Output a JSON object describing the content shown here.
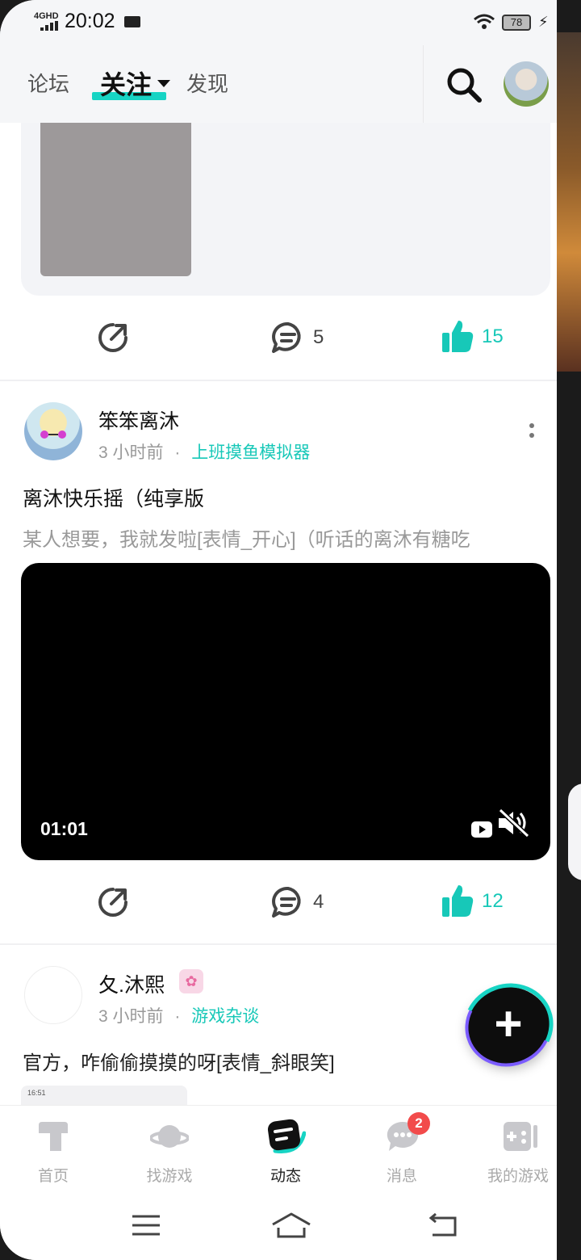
{
  "status_bar": {
    "network": "4GHD",
    "time": "20:02",
    "battery": "78"
  },
  "top_nav": {
    "tabs": [
      "论坛",
      "关注",
      "发现"
    ],
    "active_tab": "关注"
  },
  "posts": [
    {
      "comments": "5",
      "likes": "15"
    },
    {
      "author": "笨笨离沐",
      "time": "3 小时前",
      "topic": "上班摸鱼模拟器",
      "title": "离沐快乐摇（纯享版",
      "text": "某人想要，我就发啦[表情_开心]（听话的离沐有糖吃",
      "video_duration": "01:01",
      "comments": "4",
      "likes": "12"
    },
    {
      "author": "夂.沐熙",
      "time": "3 小时前",
      "topic": "游戏杂谈",
      "text": "官方，咋偷偷摸摸的呀[表情_斜眼笑]",
      "preview_time": "16:51"
    }
  ],
  "meta_separator": "·",
  "bottom_tabs": [
    {
      "label": "首页",
      "icon": "home-icon"
    },
    {
      "label": "找游戏",
      "icon": "planet-icon"
    },
    {
      "label": "动态",
      "icon": "feed-icon"
    },
    {
      "label": "消息",
      "icon": "message-icon",
      "badge": "2"
    },
    {
      "label": "我的游戏",
      "icon": "gamepad-icon"
    }
  ],
  "active_bottom_tab": "动态",
  "colors": {
    "accent": "#17d4c4",
    "like": "#17c8b8",
    "badge": "#f24b4b"
  }
}
